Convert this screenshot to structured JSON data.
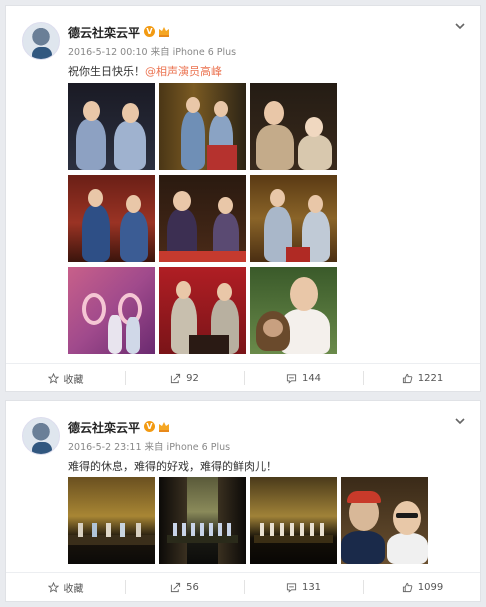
{
  "posts": [
    {
      "author": "德云社栾云平",
      "verified_badge": "V",
      "meta": "2016-5-12 00:10 来自 iPhone 6 Plus",
      "text_prefix": "祝你生日快乐！",
      "mention": "@相声演员高峰",
      "actions": {
        "favorite": "收藏",
        "repost": "92",
        "comment": "144",
        "like": "1221"
      }
    },
    {
      "author": "德云社栾云平",
      "verified_badge": "V",
      "meta": "2016-5-2 23:11 来自 iPhone 6 Plus",
      "text": "难得的休息，难得的好戏，难得的鲜肉儿！",
      "actions": {
        "favorite": "收藏",
        "repost": "56",
        "comment": "131",
        "like": "1099"
      }
    }
  ],
  "colors": {
    "accent": "#eb7350",
    "badge": "#f29a12",
    "background": "#e9ebef"
  },
  "icons": [
    "chevron-down-icon",
    "star-icon",
    "repost-icon",
    "comment-icon",
    "like-icon",
    "verified-icon",
    "crown-icon"
  ]
}
